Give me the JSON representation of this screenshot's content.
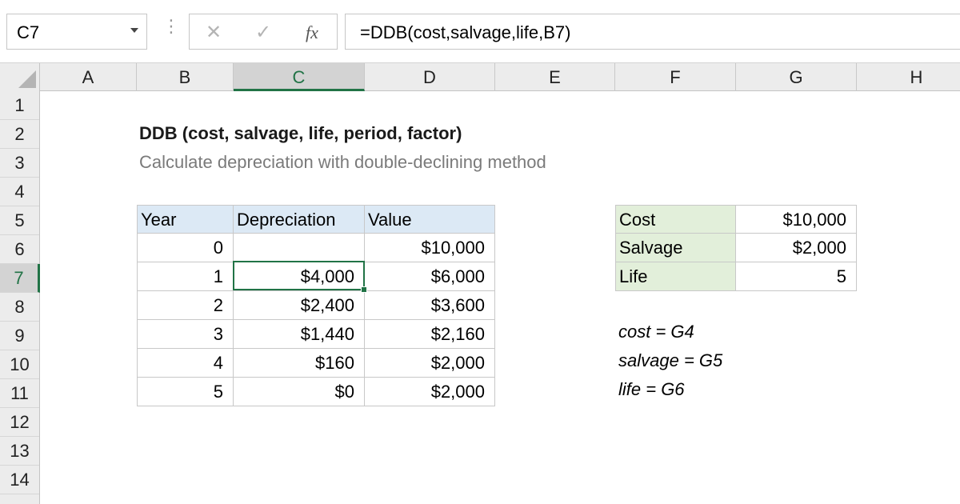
{
  "formula_bar": {
    "name_box": "C7",
    "dots": "⋮",
    "cancel_icon": "✕",
    "enter_icon": "✓",
    "fx_label": "fx",
    "formula": "=DDB(cost,salvage,life,B7)"
  },
  "columns": [
    "A",
    "B",
    "C",
    "D",
    "E",
    "F",
    "G",
    "H"
  ],
  "active_column": "C",
  "rows": [
    "1",
    "2",
    "3",
    "4",
    "5",
    "6",
    "7",
    "8",
    "9",
    "10",
    "11",
    "12",
    "13",
    "14"
  ],
  "active_row": "7",
  "sheet": {
    "title": "DDB (cost, salvage, life, period, factor)",
    "subtitle": "Calculate depreciation with double-declining method",
    "table": {
      "headers": [
        "Year",
        "Depreciation",
        "Value"
      ],
      "rows": [
        {
          "year": "0",
          "depreciation": "",
          "value": "$10,000"
        },
        {
          "year": "1",
          "depreciation": "$4,000",
          "value": "$6,000"
        },
        {
          "year": "2",
          "depreciation": "$2,400",
          "value": "$3,600"
        },
        {
          "year": "3",
          "depreciation": "$1,440",
          "value": "$2,160"
        },
        {
          "year": "4",
          "depreciation": "$160",
          "value": "$2,000"
        },
        {
          "year": "5",
          "depreciation": "$0",
          "value": "$2,000"
        }
      ]
    },
    "inputs": [
      {
        "label": "Cost",
        "value": "$10,000"
      },
      {
        "label": "Salvage",
        "value": "$2,000"
      },
      {
        "label": "Life",
        "value": "5"
      }
    ],
    "notes": [
      "cost = G4",
      "salvage = G5",
      "life = G6"
    ]
  },
  "colors": {
    "accent_green": "#217346",
    "header_blue": "#dce9f5",
    "input_green": "#e2efda"
  }
}
